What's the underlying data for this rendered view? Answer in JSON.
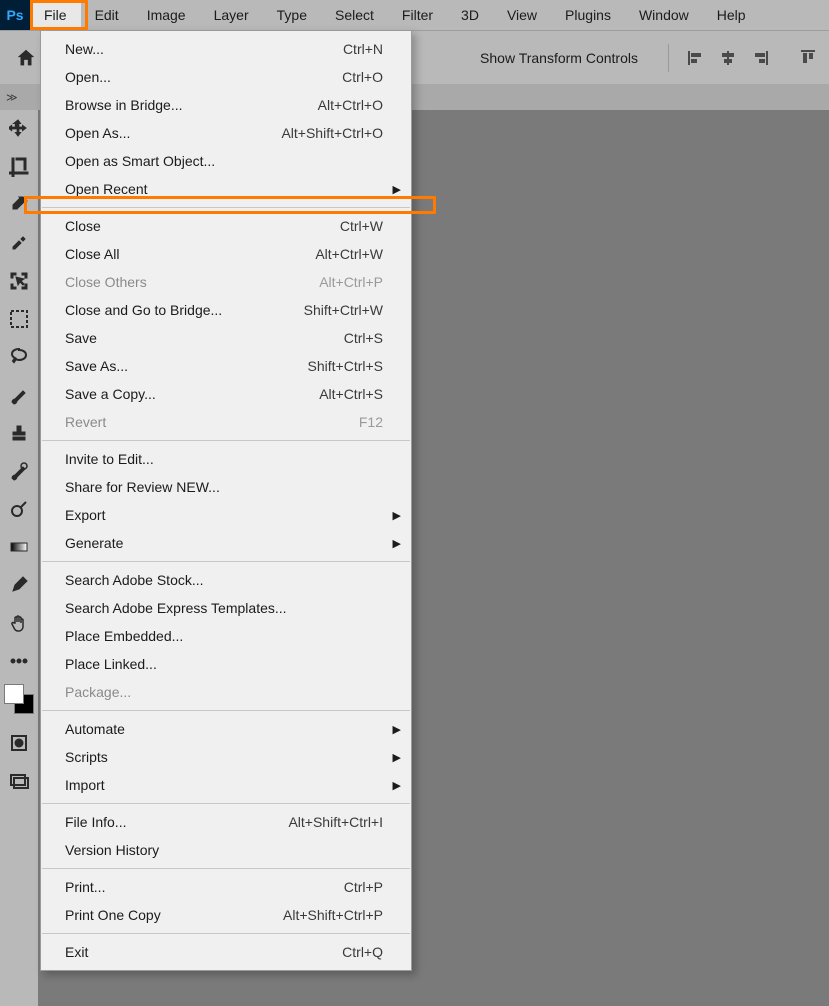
{
  "logo": "Ps",
  "menubar": [
    "File",
    "Edit",
    "Image",
    "Layer",
    "Type",
    "Select",
    "Filter",
    "3D",
    "View",
    "Plugins",
    "Window",
    "Help"
  ],
  "active_menu_index": 0,
  "optionsbar": {
    "show_transform": "Show Transform Controls"
  },
  "tools": [
    "move",
    "crop",
    "eyedropper",
    "healing-brush",
    "object-select",
    "marquee",
    "lasso",
    "brush",
    "stamp",
    "history-brush",
    "dodge",
    "gradient",
    "pen",
    "hand",
    "more"
  ],
  "file_menu": [
    {
      "t": "item",
      "label": "New...",
      "shortcut": "Ctrl+N"
    },
    {
      "t": "item",
      "label": "Open...",
      "shortcut": "Ctrl+O"
    },
    {
      "t": "item",
      "label": "Browse in Bridge...",
      "shortcut": "Alt+Ctrl+O"
    },
    {
      "t": "item",
      "label": "Open As...",
      "shortcut": "Alt+Shift+Ctrl+O"
    },
    {
      "t": "item",
      "label": "Open as Smart Object..."
    },
    {
      "t": "sub",
      "label": "Open Recent"
    },
    {
      "t": "sep",
      "highlight": true
    },
    {
      "t": "item",
      "label": "Close",
      "shortcut": "Ctrl+W"
    },
    {
      "t": "item",
      "label": "Close All",
      "shortcut": "Alt+Ctrl+W"
    },
    {
      "t": "item",
      "label": "Close Others",
      "shortcut": "Alt+Ctrl+P",
      "disabled": true
    },
    {
      "t": "item",
      "label": "Close and Go to Bridge...",
      "shortcut": "Shift+Ctrl+W"
    },
    {
      "t": "item",
      "label": "Save",
      "shortcut": "Ctrl+S"
    },
    {
      "t": "item",
      "label": "Save As...",
      "shortcut": "Shift+Ctrl+S"
    },
    {
      "t": "item",
      "label": "Save a Copy...",
      "shortcut": "Alt+Ctrl+S"
    },
    {
      "t": "item",
      "label": "Revert",
      "shortcut": "F12",
      "disabled": true
    },
    {
      "t": "sep"
    },
    {
      "t": "item",
      "label": "Invite to Edit..."
    },
    {
      "t": "item",
      "label": "Share for Review NEW..."
    },
    {
      "t": "sub",
      "label": "Export"
    },
    {
      "t": "sub",
      "label": "Generate"
    },
    {
      "t": "sep"
    },
    {
      "t": "item",
      "label": "Search Adobe Stock..."
    },
    {
      "t": "item",
      "label": "Search Adobe Express Templates..."
    },
    {
      "t": "item",
      "label": "Place Embedded..."
    },
    {
      "t": "item",
      "label": "Place Linked..."
    },
    {
      "t": "item",
      "label": "Package...",
      "disabled": true
    },
    {
      "t": "sep"
    },
    {
      "t": "sub",
      "label": "Automate"
    },
    {
      "t": "sub",
      "label": "Scripts"
    },
    {
      "t": "sub",
      "label": "Import"
    },
    {
      "t": "sep"
    },
    {
      "t": "item",
      "label": "File Info...",
      "shortcut": "Alt+Shift+Ctrl+I"
    },
    {
      "t": "item",
      "label": "Version History"
    },
    {
      "t": "sep"
    },
    {
      "t": "item",
      "label": "Print...",
      "shortcut": "Ctrl+P"
    },
    {
      "t": "item",
      "label": "Print One Copy",
      "shortcut": "Alt+Shift+Ctrl+P"
    },
    {
      "t": "sep"
    },
    {
      "t": "item",
      "label": "Exit",
      "shortcut": "Ctrl+Q"
    }
  ]
}
